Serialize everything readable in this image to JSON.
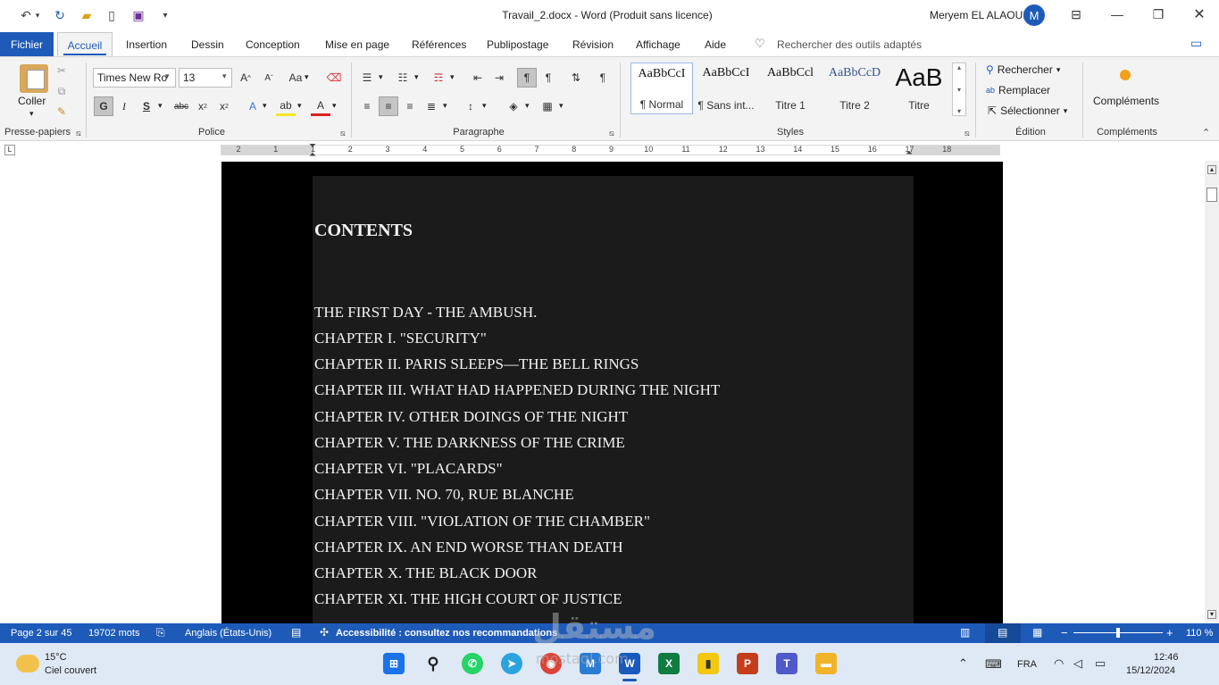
{
  "title_bar": {
    "document_title": "Travail_2.docx  -  Word (Produit sans licence)",
    "user_name": "Meryem EL ALAOUI",
    "avatar_initial": "M"
  },
  "tabs": {
    "file": "Fichier",
    "items": [
      "Accueil",
      "Insertion",
      "Dessin",
      "Conception",
      "Mise en page",
      "Références",
      "Publipostage",
      "Révision",
      "Affichage",
      "Aide"
    ],
    "search_placeholder": "Rechercher des outils adaptés"
  },
  "ribbon": {
    "clipboard": {
      "paste_label": "Coller",
      "group_label": "Presse-papiers"
    },
    "font": {
      "font_name": "Times New Ro",
      "font_size": "13",
      "group_label": "Police"
    },
    "paragraph": {
      "group_label": "Paragraphe"
    },
    "styles": {
      "group_label": "Styles",
      "tiles": [
        {
          "preview": "AaBbCcI",
          "name": "¶ Normal"
        },
        {
          "preview": "AaBbCcI",
          "name": "¶ Sans int..."
        },
        {
          "preview": "AaBbCcl",
          "name": "Titre 1"
        },
        {
          "preview": "AaBbCcD",
          "name": "Titre 2"
        },
        {
          "preview": "AaB",
          "name": "Titre"
        }
      ]
    },
    "editing": {
      "group_label": "Édition",
      "find": "Rechercher",
      "replace": "Remplacer",
      "select": "Sélectionner"
    },
    "addins": {
      "label": "Compléments",
      "group_label": "Compléments"
    }
  },
  "ruler": {
    "numbers": [
      "2",
      "1",
      "1",
      "2",
      "3",
      "4",
      "5",
      "6",
      "7",
      "8",
      "9",
      "10",
      "11",
      "12",
      "13",
      "14",
      "15",
      "16",
      "17",
      "18"
    ]
  },
  "document": {
    "heading": "CONTENTS",
    "lines": [
      "THE FIRST DAY - THE AMBUSH.",
      "CHAPTER I. \"SECURITY\"",
      "CHAPTER II. PARIS SLEEPS—THE BELL RINGS",
      "CHAPTER III. WHAT HAD HAPPENED DURING THE NIGHT",
      "CHAPTER IV. OTHER DOINGS OF THE NIGHT",
      "CHAPTER V. THE DARKNESS OF THE CRIME",
      "CHAPTER VI. \"PLACARDS\"",
      "CHAPTER VII. NO. 70, RUE BLANCHE",
      "CHAPTER VIII. \"VIOLATION OF THE CHAMBER\"",
      "CHAPTER IX. AN END WORSE THAN DEATH",
      "CHAPTER X. THE BLACK DOOR",
      "CHAPTER XI. THE HIGH COURT OF JUSTICE"
    ]
  },
  "status_bar": {
    "page": "Page 2 sur 45",
    "words": "19702 mots",
    "language": "Anglais (États-Unis)",
    "accessibility": "Accessibilité : consultez nos recommandations",
    "zoom": "110 %"
  },
  "taskbar": {
    "weather_temp": "15°C",
    "weather_desc": "Ciel couvert",
    "language": "FRA",
    "time": "12:46",
    "date": "15/12/2024"
  },
  "watermark": {
    "arabic": "مستقل",
    "latin": "mostaql.com"
  },
  "colors": {
    "accent": "#1e5bb8",
    "page_background": "#000000",
    "text_block": "#1b1b1b"
  }
}
